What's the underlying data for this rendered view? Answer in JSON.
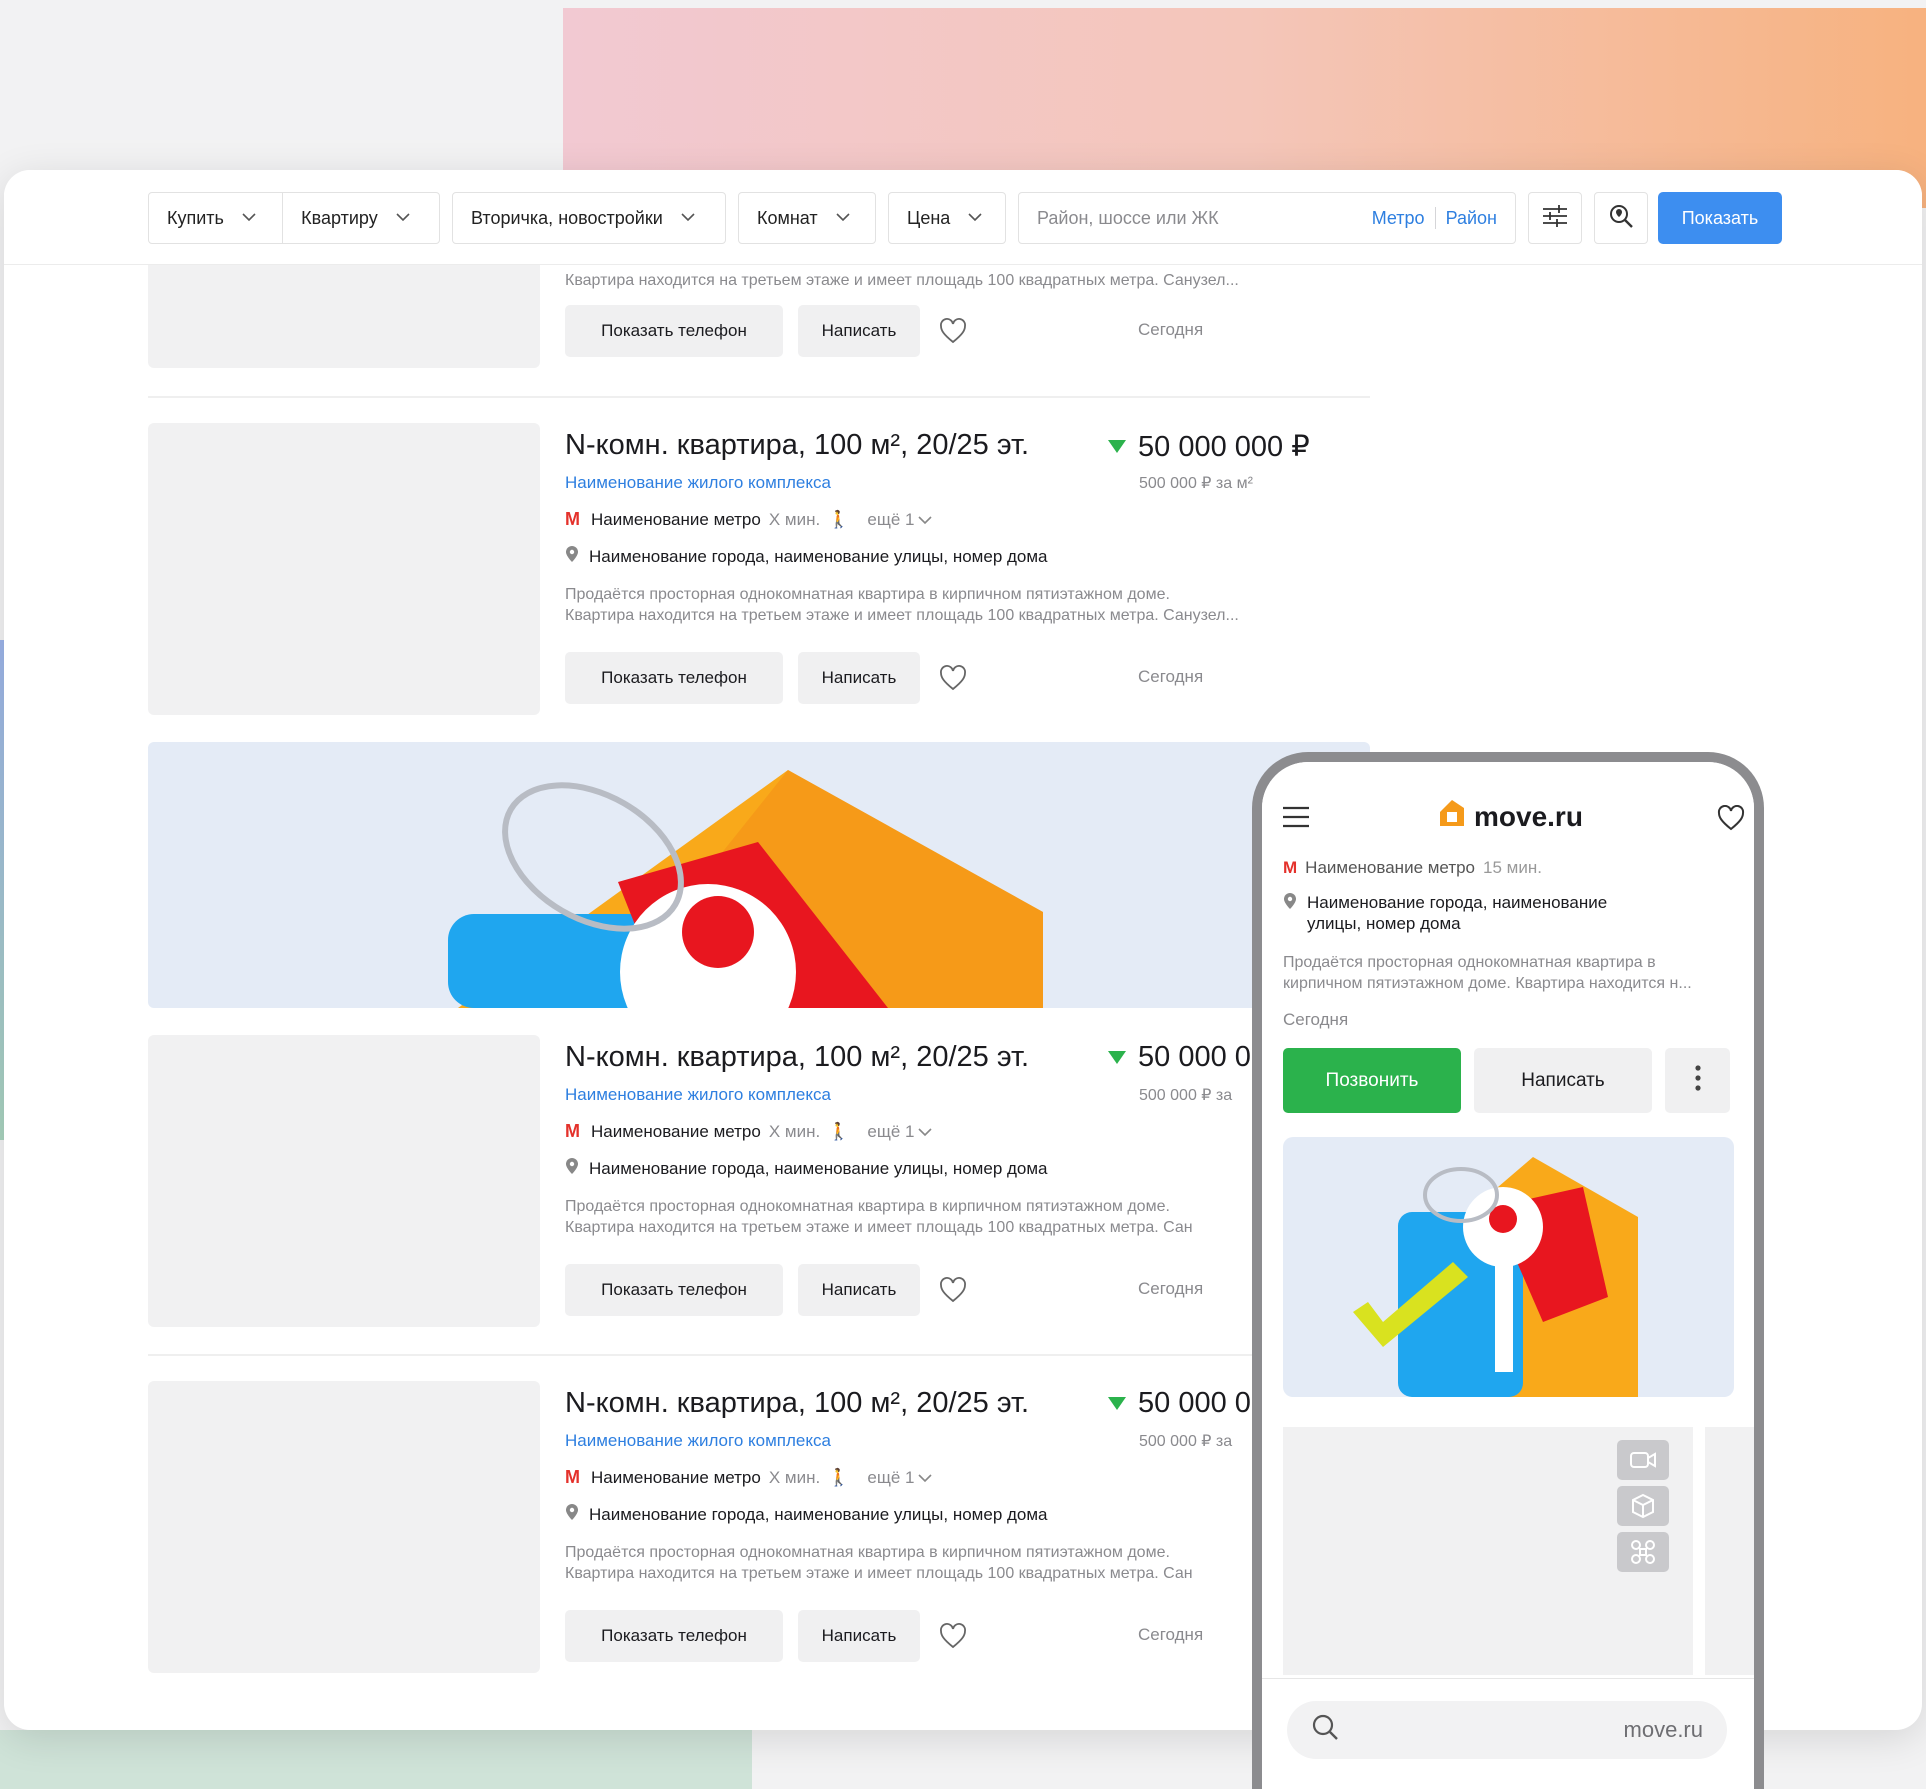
{
  "colors": {
    "accent": "#3d8ef0",
    "link": "#2e7fe0",
    "call": "#2bb24c",
    "metro": "#e4312b"
  },
  "toolbar": {
    "deal": "Купить",
    "object": "Квартиру",
    "market": "Вторичка, новостройки",
    "rooms": "Комнат",
    "price": "Цена",
    "search_placeholder": "Район, шоссе или ЖК",
    "metro_link": "Метро",
    "district_link": "Район",
    "filters_icon": "sliders-icon",
    "map_search_icon": "map-search-icon",
    "show_label": "Показать"
  },
  "listings": [
    {
      "desc_line2": "Квартира находится на третьем этаже и имеет площадь 100 квадратных метра. Санузел...",
      "phone_btn": "Показать телефон",
      "write_btn": "Написать",
      "date": "Сегодня"
    },
    {
      "title": "N-комн. квартира, 100 м², 20/25 эт.",
      "complex": "Наименование жилого комплекса",
      "price": "50 000 000 ₽",
      "price_per_m": "500 000 ₽ за м²",
      "metro": "Наименование метро",
      "metro_time": "Х мин.",
      "metro_more": "ещё 1",
      "address": "Наименование города, наименование улицы, номер дома",
      "desc_line1": "Продаётся просторная однокомнатная квартира в кирпичном пятиэтажном доме.",
      "desc_line2": "Квартира находится на третьем этаже и имеет площадь 100 квадратных метра. Санузел...",
      "phone_btn": "Показать телефон",
      "write_btn": "Написать",
      "date": "Сегодня"
    },
    {
      "title": "N-комн. квартира, 100 м², 20/25 эт.",
      "complex": "Наименование жилого комплекса",
      "price": "50 000 0",
      "price_per_m": "500 000 ₽ за",
      "metro": "Наименование метро",
      "metro_time": "Х мин.",
      "metro_more": "ещё 1",
      "address": "Наименование города, наименование улицы, номер дома",
      "desc_line1": "Продаётся просторная однокомнатная квартира в кирпичном пятиэтажном доме.",
      "desc_line2": "Квартира находится на третьем этаже и имеет площадь 100 квадратных метра. Сан",
      "phone_btn": "Показать телефон",
      "write_btn": "Написать",
      "date": "Сегодня"
    },
    {
      "title": "N-комн. квартира, 100 м², 20/25 эт.",
      "complex": "Наименование жилого комплекса",
      "price": "50 000 0",
      "price_per_m": "500 000 ₽ за",
      "metro": "Наименование метро",
      "metro_time": "Х мин.",
      "metro_more": "ещё 1",
      "address": "Наименование города, наименование улицы, номер дома",
      "desc_line1": "Продаётся просторная однокомнатная квартира в кирпичном пятиэтажном доме.",
      "desc_line2": "Квартира находится на третьем этаже и имеет площадь 100 квадратных метра. Сан",
      "phone_btn": "Показать телефон",
      "write_btn": "Написать",
      "date": "Сегодня"
    }
  ],
  "phone": {
    "logo": "move.ru",
    "menu_icon": "hamburger-icon",
    "favorite_icon": "heart-icon",
    "metro_partial": "Наименование метро",
    "metro_time_partial": "15 мин.",
    "address_line1": "Наименование города, наименование",
    "address_line2": "улицы, номер дома",
    "desc_line1": "Продаётся просторная однокомнатная квартира в",
    "desc_line2": "кирпичном пятиэтажном доме. Квартира находится н...",
    "date": "Сегодня",
    "call_btn": "Позвонить",
    "write_btn": "Написать",
    "url": "move.ru"
  }
}
